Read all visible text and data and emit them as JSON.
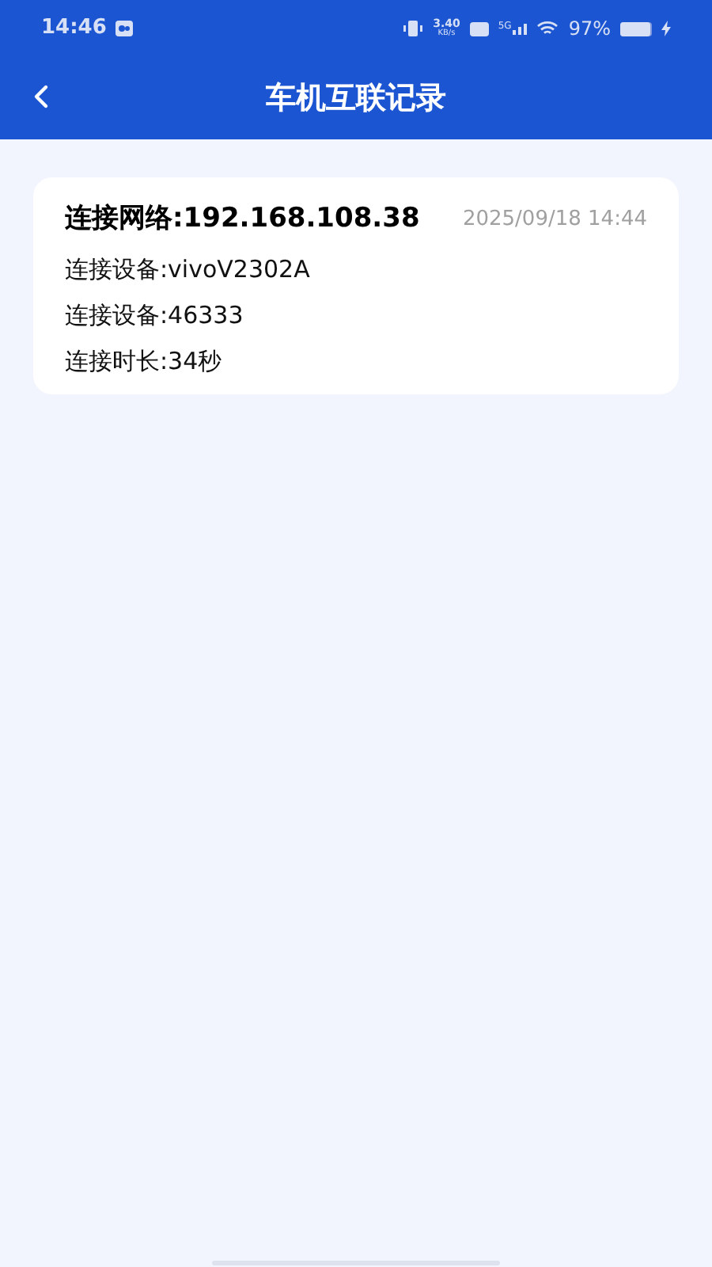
{
  "status_bar": {
    "time": "14:46",
    "speed": "3.40",
    "speed_unit": "KB/s",
    "network": "5G",
    "battery": "97%"
  },
  "header": {
    "title": "车机互联记录"
  },
  "records": [
    {
      "network": "连接网络:192.168.108.38",
      "time": "2025/09/18 14:44",
      "lines": [
        "连接设备:vivoV2302A",
        "连接设备:46333",
        "连接时长:34秒"
      ]
    }
  ]
}
